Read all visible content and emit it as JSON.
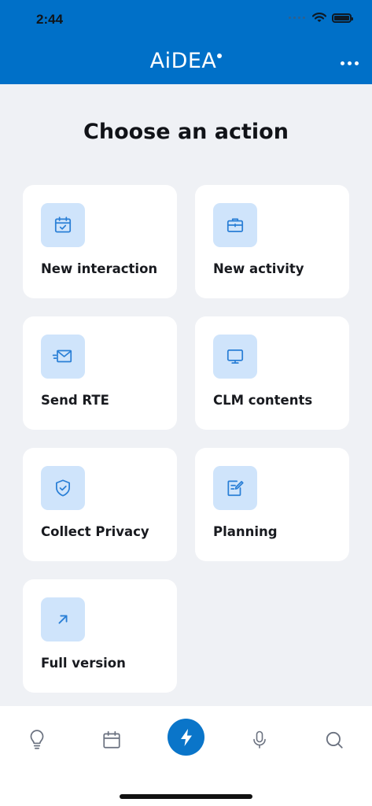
{
  "status_bar": {
    "time": "2:44"
  },
  "header": {
    "brand": "AiDEA"
  },
  "page_title": "Choose an action",
  "actions": [
    {
      "label": "New interaction",
      "icon": "calendar-check-icon"
    },
    {
      "label": "New activity",
      "icon": "briefcase-icon"
    },
    {
      "label": "Send RTE",
      "icon": "mail-send-icon"
    },
    {
      "label": "CLM contents",
      "icon": "monitor-icon"
    },
    {
      "label": "Collect Privacy",
      "icon": "shield-check-icon"
    },
    {
      "label": "Planning",
      "icon": "edit-note-icon"
    },
    {
      "label": "Full version",
      "icon": "arrow-up-right-icon"
    }
  ],
  "tabbar": {
    "tabs": [
      "lightbulb-icon",
      "calendar-icon",
      "lightning-icon",
      "microphone-icon",
      "search-icon"
    ],
    "active": "lightning-icon"
  },
  "colors": {
    "header": "#0070c8",
    "background": "#eff1f5",
    "icon_tile": "#cfe4fb",
    "icon_stroke": "#2a7fd6",
    "active_tab": "#0a75c9"
  }
}
